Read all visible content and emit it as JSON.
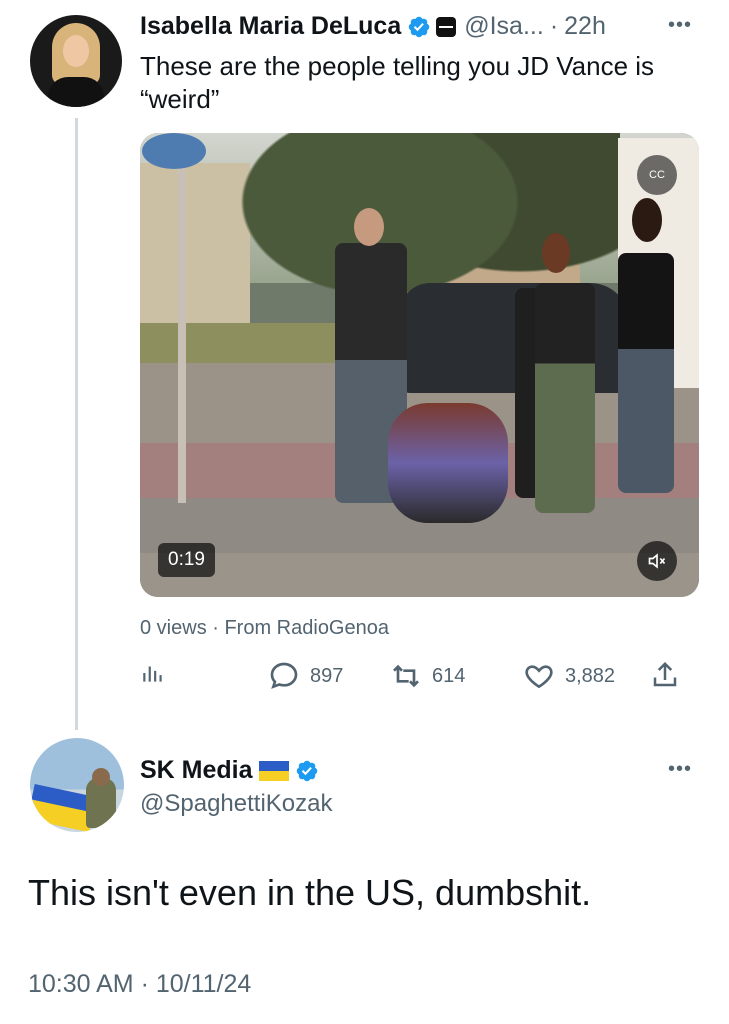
{
  "tweet_1": {
    "display_name": "Isabella Maria DeLuca",
    "handle": "@Isa...",
    "separator": "·",
    "time_ago": "22h",
    "text": "These are the people telling you JD Vance is “weird”",
    "media": {
      "duration": "0:19"
    },
    "views_source": "0 views · From RadioGenoa",
    "stats": {
      "replies": "897",
      "retweets": "614",
      "likes": "3,882"
    }
  },
  "tweet_2": {
    "display_name": "SK Media",
    "handle": "@SpaghettiKozak",
    "text": "This isn't even in the US, dumbshit.",
    "timestamp": "10:30 AM · 10/11/24"
  },
  "colors": {
    "verified_blue": "#1d9bf0",
    "secondary_text": "#536471",
    "thread_line": "#cfd9de"
  },
  "icons": [
    "verified-badge-icon",
    "organization-badge-icon",
    "more-icon",
    "captions-icon",
    "mute-icon",
    "analytics-icon",
    "reply-icon",
    "retweet-icon",
    "like-icon",
    "share-icon",
    "ukraine-flag-icon"
  ]
}
